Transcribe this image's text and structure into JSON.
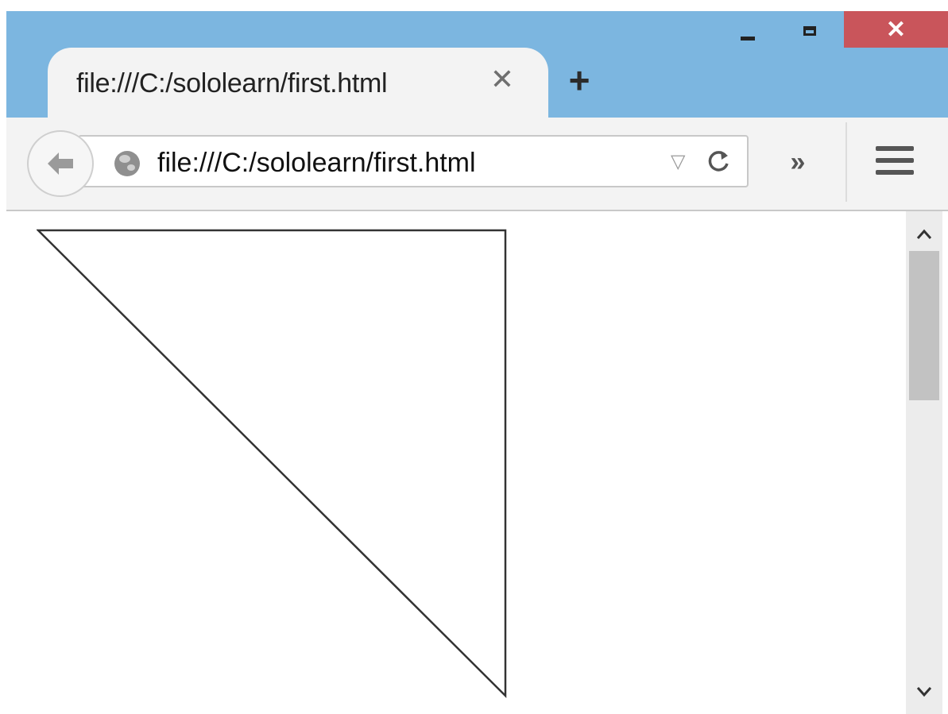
{
  "window": {
    "minimize_icon": "minimize-icon",
    "maximize_icon": "maximize-icon",
    "close_label": "✕",
    "close_color": "#c9555b",
    "frame_color": "#7cb6e0"
  },
  "tab": {
    "title": "file:///C:/sololearn/first.html",
    "close_label": "✕",
    "new_tab_label": "+"
  },
  "navbar": {
    "back_icon": "back-arrow-icon",
    "site_icon": "globe-icon",
    "url": "file:///C:/sololearn/first.html",
    "dropmarker_label": "▽",
    "reload_label": "C",
    "overflow_label": "»",
    "menu_icon": "hamburger-menu-icon"
  },
  "content": {
    "shape": "right-triangle",
    "stroke_color": "#333333"
  },
  "scrollbar": {
    "up_label": "^",
    "down_label": "v"
  }
}
